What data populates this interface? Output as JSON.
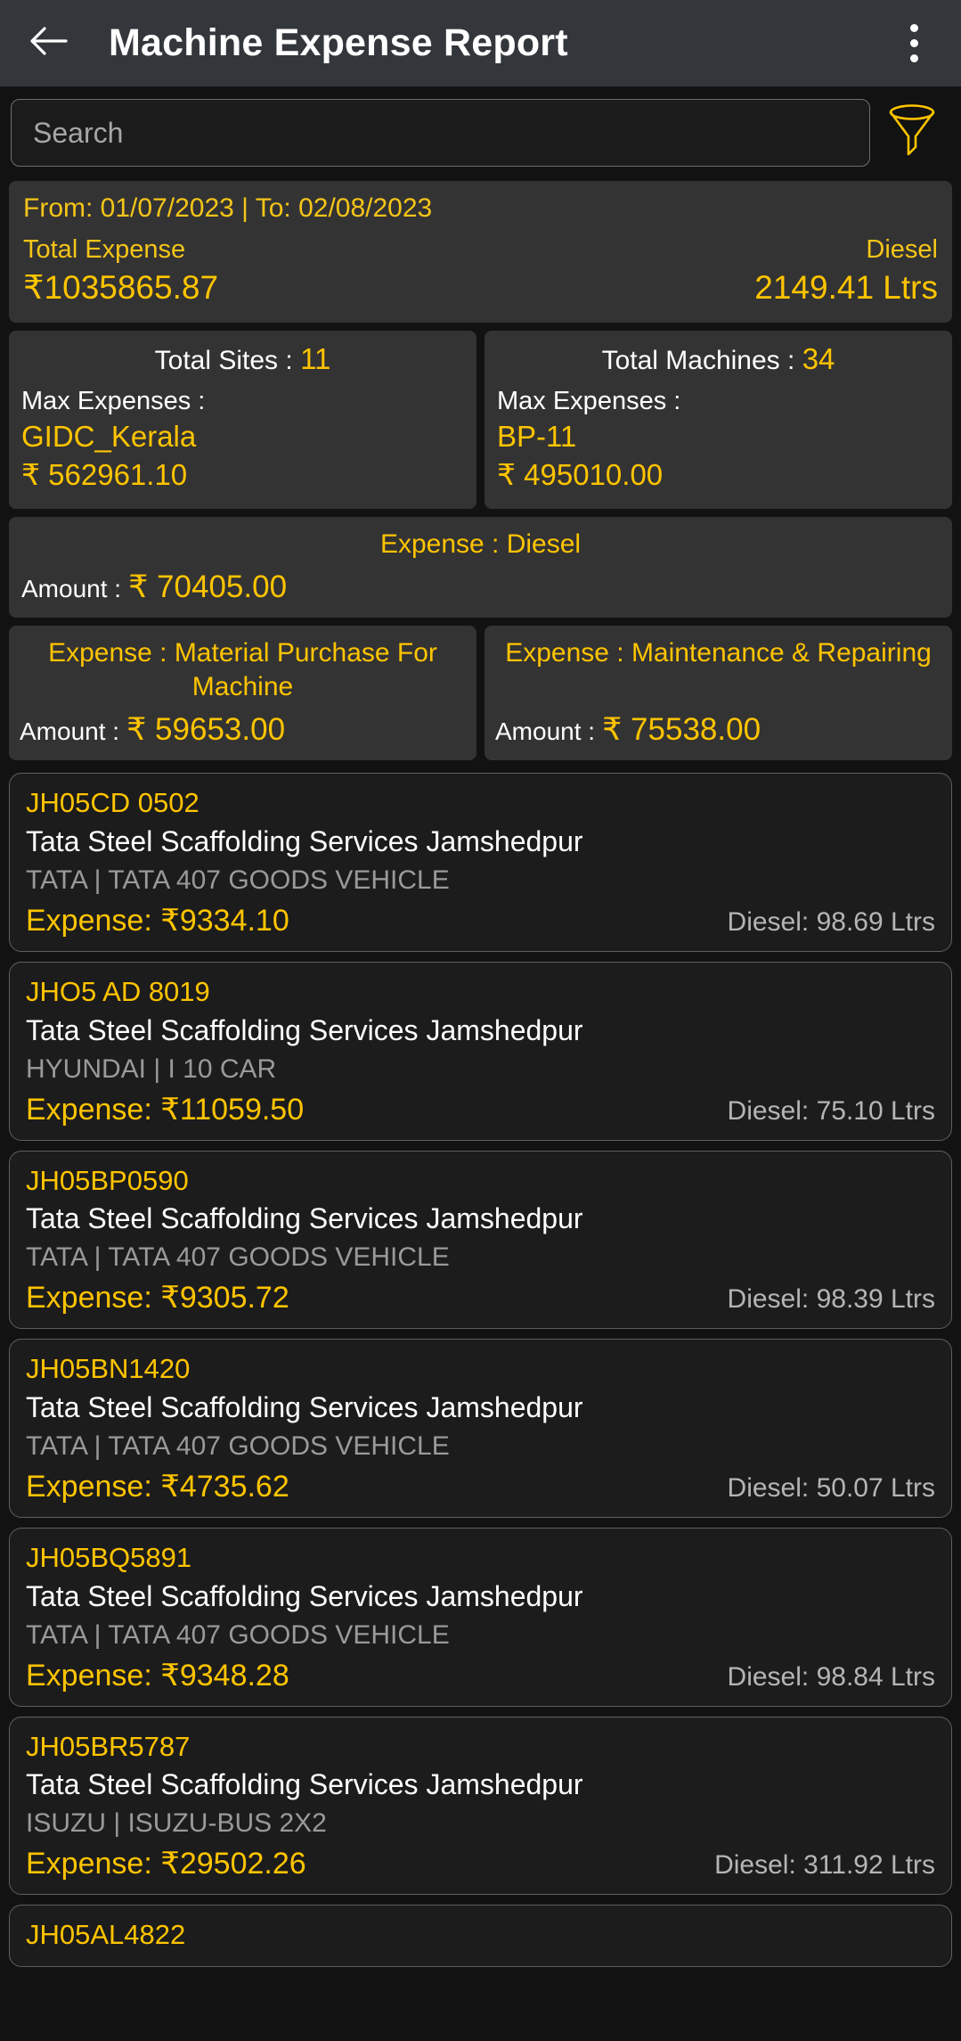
{
  "appbar": {
    "back_icon": "arrow-left-icon",
    "title": "Machine Expense Report",
    "overflow_icon": "more-vertical-icon"
  },
  "search": {
    "placeholder": "Search",
    "value": "",
    "filter_icon": "funnel-filter-icon"
  },
  "summary": {
    "date_range": "From: 01/07/2023 | To: 02/08/2023",
    "total_expense_label": "Total Expense",
    "total_expense_value": "₹1035865.87",
    "diesel_label": "Diesel",
    "diesel_value": "2149.41 Ltrs"
  },
  "stats": [
    {
      "title_label": "Total Sites : ",
      "title_count": "11",
      "sub_label": "Max Expenses :",
      "name": "GIDC_Kerala",
      "amount": "₹ 562961.10"
    },
    {
      "title_label": "Total Machines : ",
      "title_count": "34",
      "sub_label": "Max Expenses :",
      "name": "BP-11",
      "amount": "₹ 495010.00"
    }
  ],
  "expense_cards": {
    "full": {
      "title": "Expense : Diesel",
      "amount_label": "Amount :",
      "amount_value": "₹ 70405.00"
    },
    "half": [
      {
        "title": "Expense : Material Purchase For Machine",
        "amount_label": "Amount :",
        "amount_value": "₹ 59653.00"
      },
      {
        "title": "Expense : Maintenance & Repairing",
        "amount_label": "Amount :",
        "amount_value": "₹ 75538.00"
      }
    ]
  },
  "list": [
    {
      "reg": "JH05CD 0502",
      "site": "Tata Steel Scaffolding Services Jamshedpur",
      "model": "TATA | TATA 407 GOODS VEHICLE",
      "expense": "Expense: ₹9334.10",
      "diesel": "Diesel: 98.69 Ltrs"
    },
    {
      "reg": "JHO5 AD 8019",
      "site": "Tata Steel Scaffolding Services Jamshedpur",
      "model": "HYUNDAI | I 10 CAR",
      "expense": "Expense: ₹11059.50",
      "diesel": "Diesel: 75.10 Ltrs"
    },
    {
      "reg": "JH05BP0590",
      "site": "Tata Steel Scaffolding Services Jamshedpur",
      "model": "TATA | TATA 407 GOODS VEHICLE",
      "expense": "Expense: ₹9305.72",
      "diesel": "Diesel: 98.39 Ltrs"
    },
    {
      "reg": "JH05BN1420",
      "site": "Tata Steel Scaffolding Services Jamshedpur",
      "model": "TATA | TATA 407 GOODS VEHICLE",
      "expense": "Expense: ₹4735.62",
      "diesel": "Diesel: 50.07 Ltrs"
    },
    {
      "reg": "JH05BQ5891",
      "site": "Tata Steel Scaffolding Services Jamshedpur",
      "model": "TATA | TATA 407 GOODS VEHICLE",
      "expense": "Expense: ₹9348.28",
      "diesel": "Diesel: 98.84 Ltrs"
    },
    {
      "reg": "JH05BR5787",
      "site": "Tata Steel Scaffolding Services Jamshedpur",
      "model": "ISUZU | ISUZU-BUS 2X2",
      "expense": "Expense: ₹29502.26",
      "diesel": "Diesel: 311.92 Ltrs"
    },
    {
      "reg": "JH05AL4822",
      "site": "",
      "model": "",
      "expense": "",
      "diesel": ""
    }
  ],
  "colors": {
    "accent": "#ffc400",
    "accent_dim": "#f5c518",
    "appbar_bg": "#33363b",
    "card_bg": "#333333",
    "list_bg": "#1c1c1c",
    "page_bg": "#121212"
  }
}
